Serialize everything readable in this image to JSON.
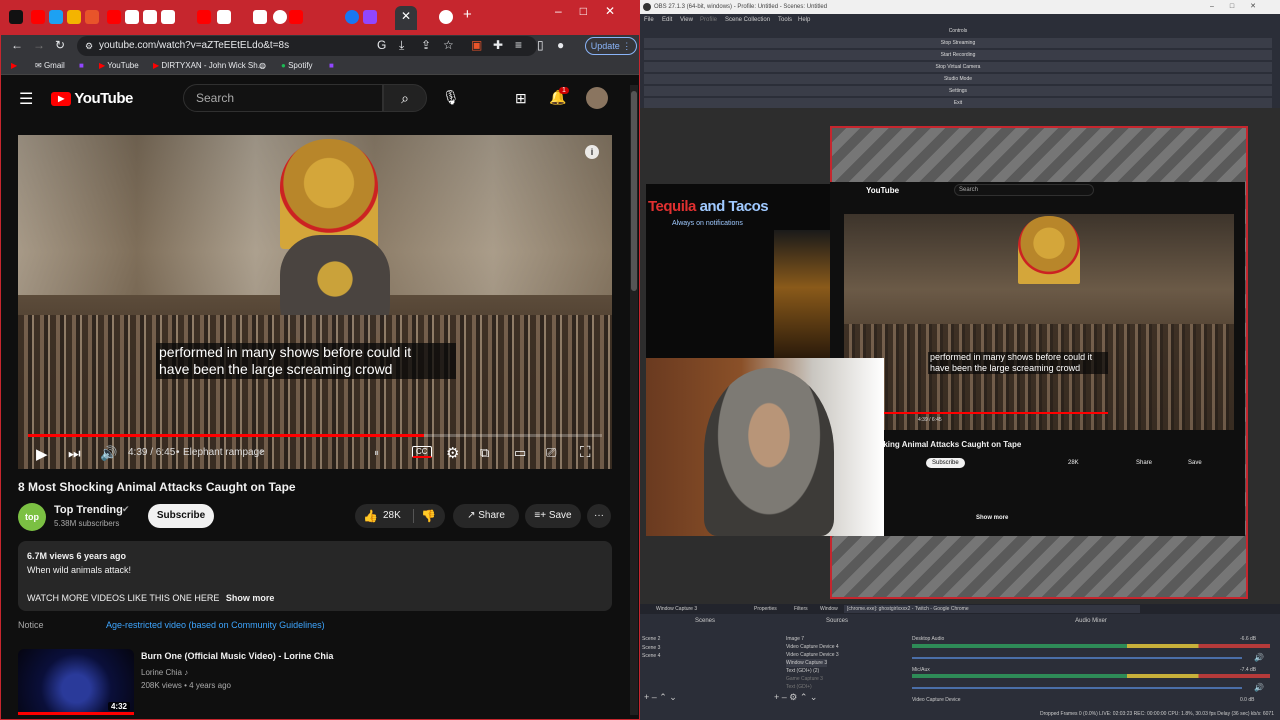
{
  "browser": {
    "url": "youtube.com/watch?v=aZTeEEtELdo&t=8s",
    "update_label": "Update",
    "bookmarks": [
      "Gmail",
      "YouTube",
      "DIRTYXAN - John Wick Sh...",
      "Spotify"
    ],
    "accent": "#c6262e"
  },
  "youtube": {
    "logo": "YouTube",
    "search_placeholder": "Search",
    "notification_count": "1",
    "caption_line1": "performed in many shows before could it",
    "caption_line2": "have been the large screaming crowd",
    "time": "4:39 / 6:45",
    "chapter": "Elephant rampage",
    "chapter_arrow": "›",
    "progress_fraction": 0.69,
    "video_title": "8 Most Shocking Animal Attacks Caught on Tape",
    "channel_name": "Top Trending",
    "channel_avatar": "top",
    "subscribers": "5.38M subscribers",
    "subscribe_label": "Subscribe",
    "likes": "28K",
    "share_label": "Share",
    "save_label": "Save",
    "more_label": "···",
    "views_date": "6.7M views  6 years ago",
    "desc_line1": "When wild animals attack!",
    "desc_line2": "WATCH MORE VIDEOS LIKE THIS ONE HERE",
    "show_more": "Show more",
    "notice_label": "Notice",
    "notice_value": "Age-restricted video (based on Community Guidelines)",
    "rec_title": "Burn One (Official Music Video) - Lorine Chia",
    "rec_channel": "Lorine Chia",
    "rec_meta": "208K views  •  4 years ago",
    "rec_duration": "4:32"
  },
  "obs": {
    "title": "OBS 27.1.3 (64-bit, windows) - Profile: Untitled - Scenes: Untitled",
    "menu": [
      "File",
      "Edit",
      "View",
      "Profile",
      "Scene Collection",
      "Tools",
      "Help"
    ],
    "controls_header": "Controls",
    "controls": [
      "Stop Streaming",
      "Start Recording",
      "Stop Virtual Camera",
      "Studio Mode",
      "Settings",
      "Exit"
    ],
    "banner_title_a": "Tequila",
    "banner_title_b": "and Tacos",
    "banner_sub": "Always on notifications",
    "source_bar_label": "Window Capture 3",
    "properties_label": "Properties",
    "filters_label": "Filters",
    "window_label": "Window",
    "window_value": "[chrome.exe]: ghostgirlxxxx2 - Twitch - Google Chrome",
    "scenes_title": "Scenes",
    "scenes": [
      "Scene 2",
      "Scene 3",
      "Scene 4"
    ],
    "sources_title": "Sources",
    "sources": [
      "Image 7",
      "Video Capture Device 4",
      "Video Capture Device 3",
      "Window Capture 3",
      "Text (GDI+) (2)",
      "Game Capture 3",
      "Text (GDI+)"
    ],
    "mixer_title": "Audio Mixer",
    "mixer": [
      {
        "name": "Desktop Audio",
        "db": "-6.6 dB"
      },
      {
        "name": "Mic/Aux",
        "db": "-7.4 dB"
      },
      {
        "name": "Video Capture Device",
        "db": "0.0 dB"
      }
    ],
    "status": "Dropped Frames 0 (0.0%)    LIVE: 02:03:23    REC: 00:00:00    CPU: 1.8%, 30.03 fps    Delay (36 sec)    kb/s: 6071"
  }
}
